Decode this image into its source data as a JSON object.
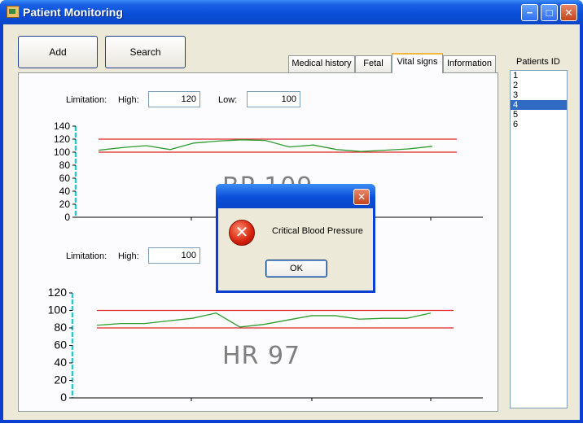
{
  "window": {
    "title": "Patient Monitoring"
  },
  "toolbar": {
    "add_label": "Add",
    "search_label": "Search"
  },
  "tabs": [
    {
      "label": "Medical history",
      "active": false
    },
    {
      "label": "Fetal",
      "active": false
    },
    {
      "label": "Vital signs",
      "active": true
    },
    {
      "label": "Information",
      "active": false
    }
  ],
  "bp_section": {
    "limitation_label": "Limitation:",
    "high_label": "High:",
    "high_value": "120",
    "low_label": "Low:",
    "low_value": "100",
    "readout": "BP 109"
  },
  "hr_section": {
    "limitation_label": "Limitation:",
    "high_label": "High:",
    "high_value": "100",
    "readout": "HR 97"
  },
  "patients": {
    "title": "Patients ID",
    "items": [
      "1",
      "2",
      "3",
      "4",
      "5",
      "6"
    ],
    "selected": "4"
  },
  "dialog": {
    "message": "Critical Blood Pressure",
    "ok_label": "OK"
  },
  "colors": {
    "limit_line": "#e0262b",
    "series_line": "#2e9c2e",
    "y_axis": "#2ec8c8"
  },
  "chart_data": [
    {
      "type": "line",
      "ylim": [
        0,
        140
      ],
      "yticks": [
        0,
        20,
        40,
        60,
        80,
        100,
        120,
        140
      ],
      "limits": {
        "high": 120,
        "low": 100
      },
      "series": [
        {
          "values": [
            103,
            107,
            110,
            104,
            114,
            117,
            119,
            118,
            108,
            111,
            104,
            101,
            103,
            105,
            109
          ]
        }
      ]
    },
    {
      "type": "line",
      "ylim": [
        0,
        120
      ],
      "yticks": [
        0,
        20,
        40,
        60,
        80,
        100,
        120
      ],
      "limits": {
        "high": 100,
        "low": 80
      },
      "series": [
        {
          "values": [
            83,
            85,
            85,
            88,
            91,
            97,
            81,
            84,
            89,
            94,
            94,
            90,
            91,
            91,
            97
          ]
        }
      ]
    }
  ]
}
